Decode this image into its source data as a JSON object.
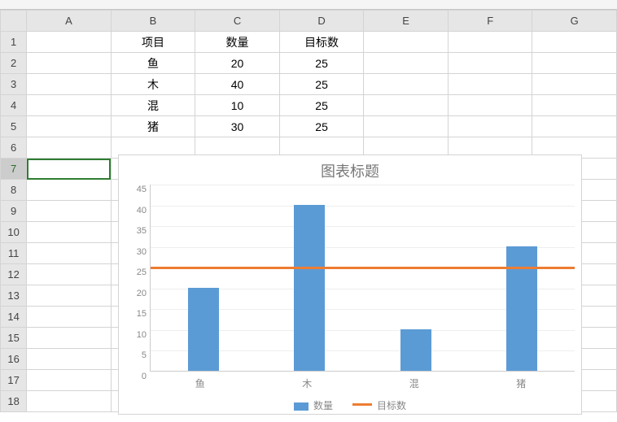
{
  "columns": [
    "A",
    "B",
    "C",
    "D",
    "E",
    "F",
    "G"
  ],
  "row_count": 18,
  "selected_cell": {
    "row": 7,
    "col": "A"
  },
  "cells": {
    "B1": "项目",
    "C1": "数量",
    "D1": "目标数",
    "B2": "鱼",
    "C2": "20",
    "D2": "25",
    "B3": "木",
    "C3": "40",
    "D3": "25",
    "B4": "混",
    "C4": "10",
    "D4": "25",
    "B5": "猪",
    "C5": "30",
    "D5": "25"
  },
  "chart_data": {
    "type": "bar",
    "title": "图表标题",
    "categories": [
      "鱼",
      "木",
      "混",
      "猪"
    ],
    "series": [
      {
        "name": "数量",
        "values": [
          20,
          40,
          10,
          30
        ],
        "color": "#5B9BD5",
        "render": "bar"
      },
      {
        "name": "目标数",
        "values": [
          25,
          25,
          25,
          25
        ],
        "color": "#ED7D31",
        "render": "line"
      }
    ],
    "ylim": [
      0,
      45
    ],
    "y_ticks": [
      0,
      5,
      10,
      15,
      20,
      25,
      30,
      35,
      40,
      45
    ],
    "xlabel": "",
    "ylabel": ""
  },
  "legend": {
    "items": [
      "数量",
      "目标数"
    ]
  }
}
